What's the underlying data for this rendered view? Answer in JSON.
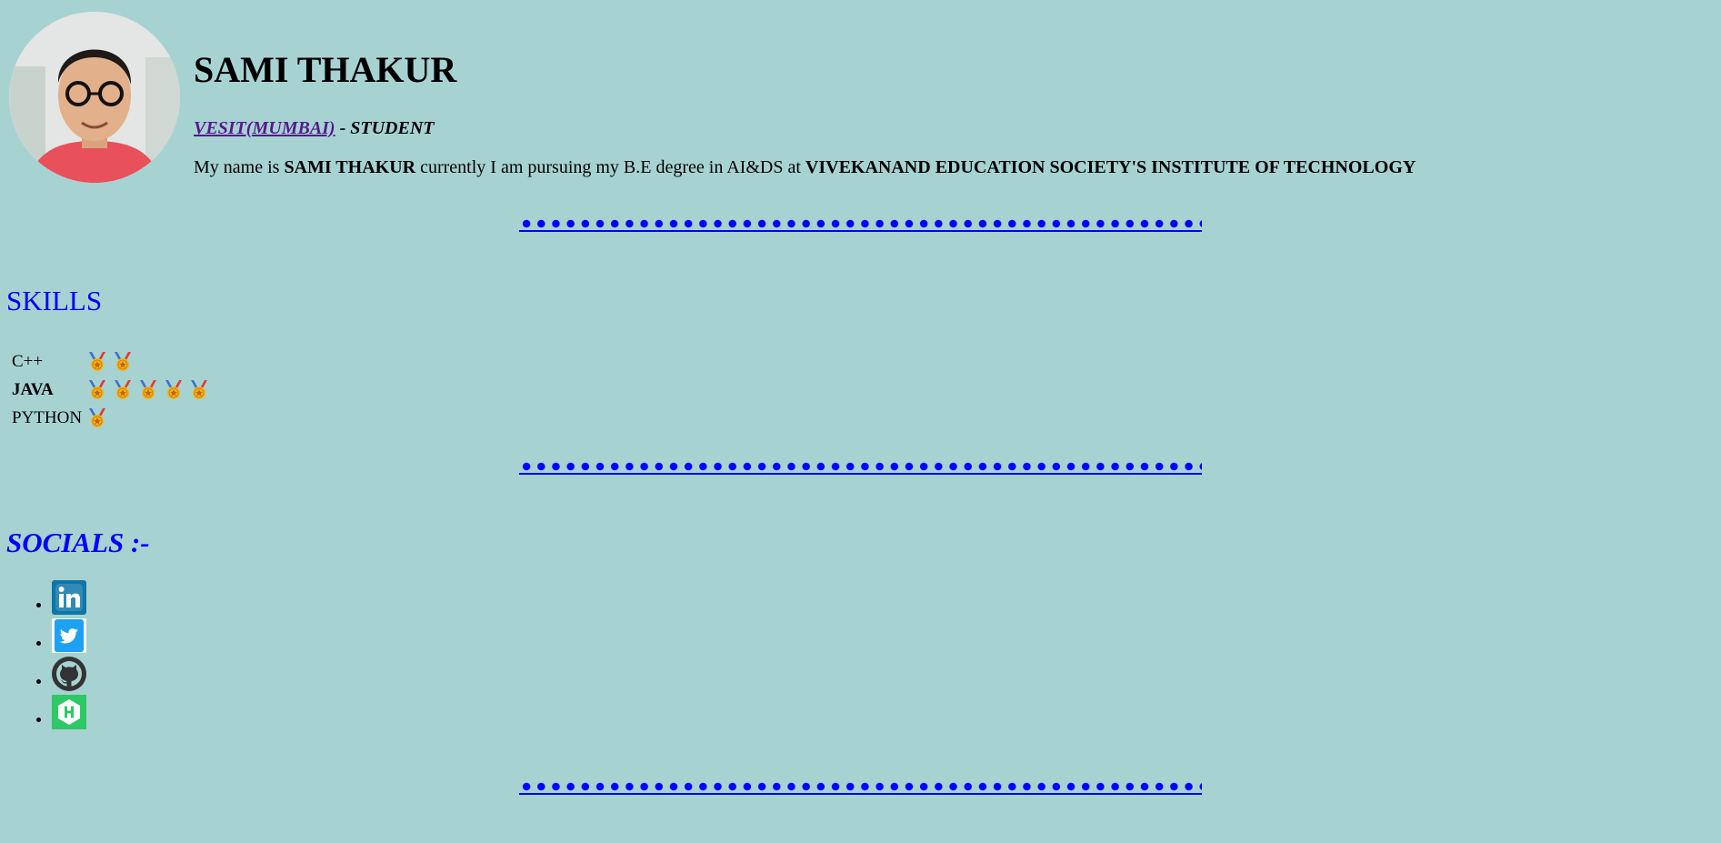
{
  "profile": {
    "name": "SAMI THAKUR",
    "college_link": "VESIT(MUMBAI)",
    "role_suffix": " - STUDENT",
    "bio": {
      "part1": "My name is ",
      "name_bold": "SAMI THAKUR",
      "part2": " currently I am pursuing my B.E degree in AI&DS at ",
      "institute_bold": "VIVEKANAND EDUCATION SOCIETY'S INSTITUTE OF TECHNOLOGY"
    }
  },
  "skills": {
    "title": "SKILLS",
    "items": [
      {
        "label": "C++",
        "bold": false,
        "rating": 2
      },
      {
        "label": "JAVA",
        "bold": true,
        "rating": 5
      },
      {
        "label": "PYTHON",
        "bold": false,
        "rating": 1
      }
    ]
  },
  "socials": {
    "title": "SOCIALS :-",
    "links": [
      {
        "icon": "linkedin-icon",
        "color": "#0e76a8"
      },
      {
        "icon": "twitter-icon",
        "color": "#1da1f2"
      },
      {
        "icon": "github-icon",
        "color": "#333333"
      },
      {
        "icon": "hackerrank-icon",
        "color": "#2ec866"
      }
    ]
  },
  "colors": {
    "background": "#a7d2d2",
    "accent": "#0000ff",
    "visited_link": "#551a8b",
    "medal_gold": "#f5b41e",
    "medal_ribbon_red": "#e53935",
    "medal_ribbon_blue": "#3f6fd1"
  }
}
